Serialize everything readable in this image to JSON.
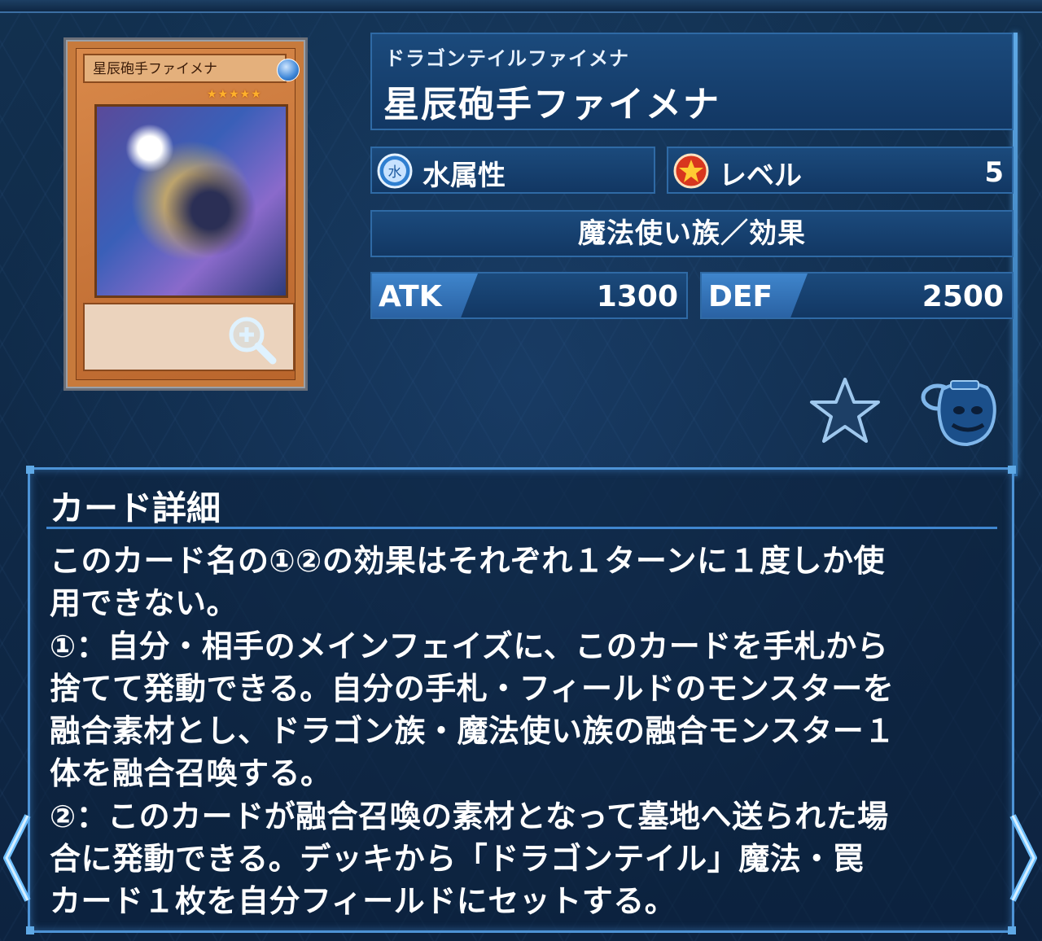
{
  "card": {
    "image_name": "星辰砲手ファイメナ",
    "ruby": "ドラゴンテイルファイメナ",
    "name": "星辰砲手ファイメナ",
    "attribute": "水属性",
    "attribute_icon_glyph": "水",
    "level_label": "レベル",
    "level": "5",
    "type_line": "魔法使い族／効果",
    "atk_label": "ATK",
    "atk": "1300",
    "def_label": "DEF",
    "def": "2500",
    "stars": "★★★★★",
    "colors": {
      "frame": "#c77a3c",
      "accent": "#2f6aa5",
      "panel": "#123763"
    }
  },
  "detail": {
    "title": "カード詳細",
    "text": "このカード名の①②の効果はそれぞれ１ターンに１度しか使\n用できない。\n①：自分・相手のメインフェイズに、このカードを手札から\n捨てて発動できる。自分の手札・フィールドのモンスターを\n融合素材とし、ドラゴン族・魔法使い族の融合モンスター１\n体を融合召喚する。\n②：このカードが融合召喚の素材となって墓地へ送られた場\n合に発動できる。デッキから「ドラゴンテイル」魔法・罠\nカード１枚を自分フィールドにセットする。"
  },
  "icons": [
    "zoom-icon",
    "water-attribute-icon",
    "level-star-icon",
    "favorite-star-icon",
    "pot-of-greed-icon",
    "chevron-left-icon",
    "chevron-right-icon"
  ]
}
